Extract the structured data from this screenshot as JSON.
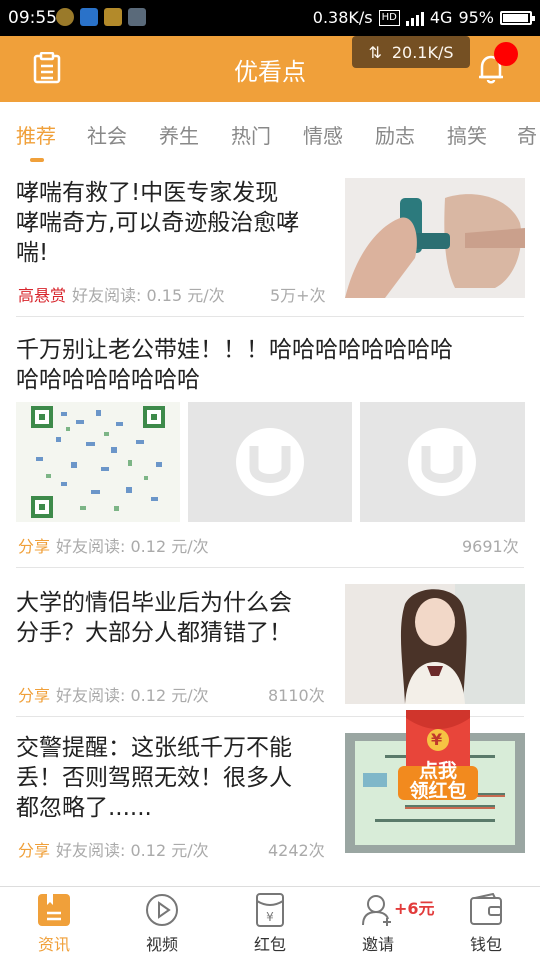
{
  "status": {
    "time": "09:55",
    "speed": "0.38K/s",
    "network": "4G",
    "battery": "95%"
  },
  "app": {
    "title": "优看点",
    "speed_badge": "20.1K/S"
  },
  "tabs": [
    "推荐",
    "社会",
    "养生",
    "热门",
    "情感",
    "励志",
    "搞笑",
    "奇"
  ],
  "articles": [
    {
      "title_lines": [
        "哮喘有救了!中医专家发现",
        "哮喘奇方,可以奇迹般治愈哮",
        "喘!"
      ],
      "tag": "高悬赏",
      "reward": "好友阅读: 0.15 元/次",
      "count": "5万+次"
    },
    {
      "title_lines": [
        "千万别让老公带娃！！！哈哈哈哈哈哈哈哈",
        "哈哈哈哈哈哈哈哈"
      ],
      "tag": "分享",
      "reward": "好友阅读: 0.12 元/次",
      "count": "9691次"
    },
    {
      "title_lines": [
        "大学的情侣毕业后为什么会",
        "分手？大部分人都猜错了！"
      ],
      "tag": "分享",
      "reward": "好友阅读: 0.12 元/次",
      "count": "8110次"
    },
    {
      "title_lines": [
        "交警提醒：这张纸千万不能",
        "丢！否则驾照无效！很多人",
        "都忽略了......"
      ],
      "tag": "分享",
      "reward": "好友阅读: 0.12 元/次",
      "count": "4242次"
    }
  ],
  "redpacket": {
    "line1": "点我",
    "line2": "领红包",
    "symbol": "¥"
  },
  "nav": {
    "items": [
      "资讯",
      "视频",
      "红包",
      "邀请",
      "钱包"
    ],
    "invite_bonus": "+6元"
  },
  "colors": {
    "accent": "#f0a03a",
    "red": "#d8262d"
  }
}
